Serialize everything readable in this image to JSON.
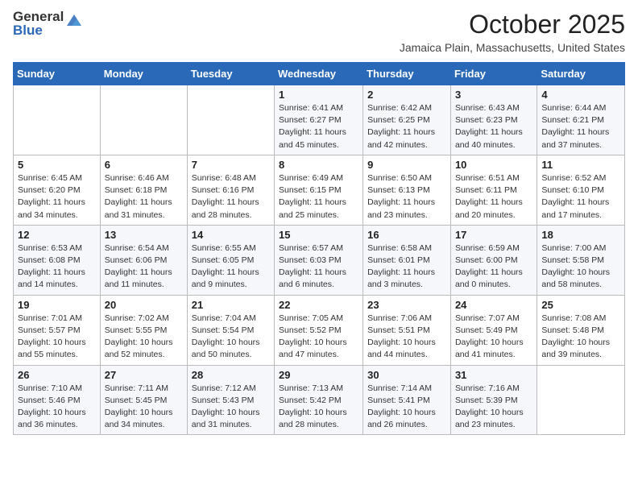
{
  "header": {
    "logo_general": "General",
    "logo_blue": "Blue",
    "month_title": "October 2025",
    "location": "Jamaica Plain, Massachusetts, United States"
  },
  "days_of_week": [
    "Sunday",
    "Monday",
    "Tuesday",
    "Wednesday",
    "Thursday",
    "Friday",
    "Saturday"
  ],
  "weeks": [
    [
      {
        "num": "",
        "info": ""
      },
      {
        "num": "",
        "info": ""
      },
      {
        "num": "",
        "info": ""
      },
      {
        "num": "1",
        "info": "Sunrise: 6:41 AM\nSunset: 6:27 PM\nDaylight: 11 hours\nand 45 minutes."
      },
      {
        "num": "2",
        "info": "Sunrise: 6:42 AM\nSunset: 6:25 PM\nDaylight: 11 hours\nand 42 minutes."
      },
      {
        "num": "3",
        "info": "Sunrise: 6:43 AM\nSunset: 6:23 PM\nDaylight: 11 hours\nand 40 minutes."
      },
      {
        "num": "4",
        "info": "Sunrise: 6:44 AM\nSunset: 6:21 PM\nDaylight: 11 hours\nand 37 minutes."
      }
    ],
    [
      {
        "num": "5",
        "info": "Sunrise: 6:45 AM\nSunset: 6:20 PM\nDaylight: 11 hours\nand 34 minutes."
      },
      {
        "num": "6",
        "info": "Sunrise: 6:46 AM\nSunset: 6:18 PM\nDaylight: 11 hours\nand 31 minutes."
      },
      {
        "num": "7",
        "info": "Sunrise: 6:48 AM\nSunset: 6:16 PM\nDaylight: 11 hours\nand 28 minutes."
      },
      {
        "num": "8",
        "info": "Sunrise: 6:49 AM\nSunset: 6:15 PM\nDaylight: 11 hours\nand 25 minutes."
      },
      {
        "num": "9",
        "info": "Sunrise: 6:50 AM\nSunset: 6:13 PM\nDaylight: 11 hours\nand 23 minutes."
      },
      {
        "num": "10",
        "info": "Sunrise: 6:51 AM\nSunset: 6:11 PM\nDaylight: 11 hours\nand 20 minutes."
      },
      {
        "num": "11",
        "info": "Sunrise: 6:52 AM\nSunset: 6:10 PM\nDaylight: 11 hours\nand 17 minutes."
      }
    ],
    [
      {
        "num": "12",
        "info": "Sunrise: 6:53 AM\nSunset: 6:08 PM\nDaylight: 11 hours\nand 14 minutes."
      },
      {
        "num": "13",
        "info": "Sunrise: 6:54 AM\nSunset: 6:06 PM\nDaylight: 11 hours\nand 11 minutes."
      },
      {
        "num": "14",
        "info": "Sunrise: 6:55 AM\nSunset: 6:05 PM\nDaylight: 11 hours\nand 9 minutes."
      },
      {
        "num": "15",
        "info": "Sunrise: 6:57 AM\nSunset: 6:03 PM\nDaylight: 11 hours\nand 6 minutes."
      },
      {
        "num": "16",
        "info": "Sunrise: 6:58 AM\nSunset: 6:01 PM\nDaylight: 11 hours\nand 3 minutes."
      },
      {
        "num": "17",
        "info": "Sunrise: 6:59 AM\nSunset: 6:00 PM\nDaylight: 11 hours\nand 0 minutes."
      },
      {
        "num": "18",
        "info": "Sunrise: 7:00 AM\nSunset: 5:58 PM\nDaylight: 10 hours\nand 58 minutes."
      }
    ],
    [
      {
        "num": "19",
        "info": "Sunrise: 7:01 AM\nSunset: 5:57 PM\nDaylight: 10 hours\nand 55 minutes."
      },
      {
        "num": "20",
        "info": "Sunrise: 7:02 AM\nSunset: 5:55 PM\nDaylight: 10 hours\nand 52 minutes."
      },
      {
        "num": "21",
        "info": "Sunrise: 7:04 AM\nSunset: 5:54 PM\nDaylight: 10 hours\nand 50 minutes."
      },
      {
        "num": "22",
        "info": "Sunrise: 7:05 AM\nSunset: 5:52 PM\nDaylight: 10 hours\nand 47 minutes."
      },
      {
        "num": "23",
        "info": "Sunrise: 7:06 AM\nSunset: 5:51 PM\nDaylight: 10 hours\nand 44 minutes."
      },
      {
        "num": "24",
        "info": "Sunrise: 7:07 AM\nSunset: 5:49 PM\nDaylight: 10 hours\nand 41 minutes."
      },
      {
        "num": "25",
        "info": "Sunrise: 7:08 AM\nSunset: 5:48 PM\nDaylight: 10 hours\nand 39 minutes."
      }
    ],
    [
      {
        "num": "26",
        "info": "Sunrise: 7:10 AM\nSunset: 5:46 PM\nDaylight: 10 hours\nand 36 minutes."
      },
      {
        "num": "27",
        "info": "Sunrise: 7:11 AM\nSunset: 5:45 PM\nDaylight: 10 hours\nand 34 minutes."
      },
      {
        "num": "28",
        "info": "Sunrise: 7:12 AM\nSunset: 5:43 PM\nDaylight: 10 hours\nand 31 minutes."
      },
      {
        "num": "29",
        "info": "Sunrise: 7:13 AM\nSunset: 5:42 PM\nDaylight: 10 hours\nand 28 minutes."
      },
      {
        "num": "30",
        "info": "Sunrise: 7:14 AM\nSunset: 5:41 PM\nDaylight: 10 hours\nand 26 minutes."
      },
      {
        "num": "31",
        "info": "Sunrise: 7:16 AM\nSunset: 5:39 PM\nDaylight: 10 hours\nand 23 minutes."
      },
      {
        "num": "",
        "info": ""
      }
    ]
  ]
}
